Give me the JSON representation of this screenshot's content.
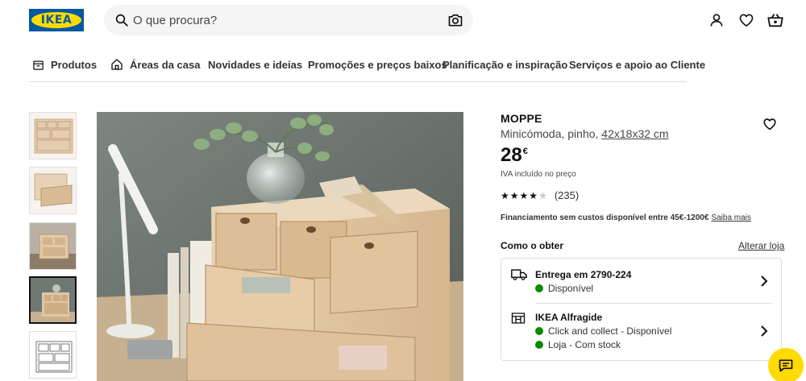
{
  "brand": {
    "logo_text": "IKEA",
    "primary": "#0058a3",
    "accent": "#ffdb00"
  },
  "search": {
    "placeholder": "O que procura?",
    "icon": "search-icon",
    "camera_icon": "camera-icon"
  },
  "header_icons": [
    "user-icon",
    "heart-icon",
    "cart-icon"
  ],
  "nav": {
    "items": [
      {
        "label": "Produtos",
        "icon": "box-icon"
      },
      {
        "label": "Áreas da casa",
        "icon": "home-icon"
      },
      {
        "label": "Novidades e ideias"
      },
      {
        "label": "Promoções e preços baixos"
      },
      {
        "label": "Planificação e inspiração"
      },
      {
        "label": "Serviços e apoio ao Cliente"
      }
    ]
  },
  "gallery": {
    "thumbnail_count": 5,
    "active_index": 3
  },
  "product": {
    "name": "MOPPE",
    "description": "Minicómoda, pinho,",
    "dimensions": "42x18x32 cm",
    "price": "28",
    "currency": "€",
    "vat_note": "IVA incluído no preço",
    "rating": 4.0,
    "reviews": "(235)",
    "finance_text": "Financiamento sem custos disponível entre 45€-1200€",
    "finance_link": "Saiba mais"
  },
  "availability": {
    "title": "Como o obter",
    "change_store": "Alterar loja",
    "delivery": {
      "title": "Entrega em 2790-224",
      "status": "Disponível"
    },
    "store": {
      "title": "IKEA Alfragide",
      "click_collect": "Click and collect - Disponível",
      "in_store": "Loja - Com stock"
    },
    "status_color": "#0a8a00"
  }
}
